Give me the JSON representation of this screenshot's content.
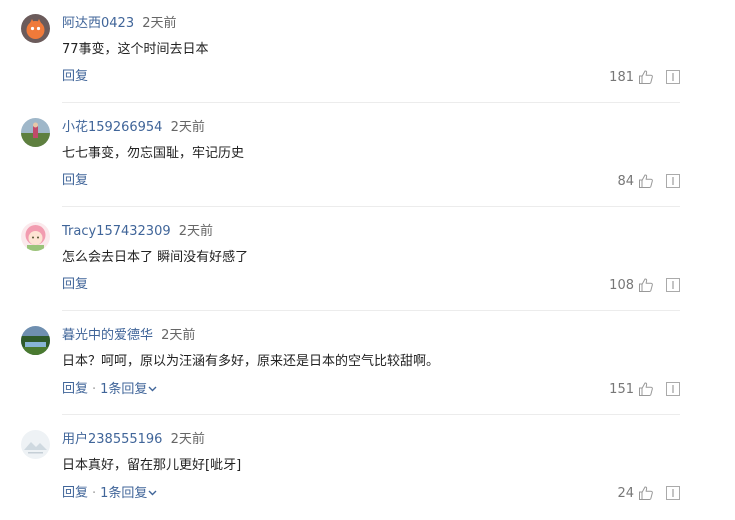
{
  "comments": [
    {
      "username": "阿达西0423",
      "time": "2天前",
      "content": "77事变，这个时间去日本",
      "reply_label": "回复",
      "likes": "181",
      "avatar": "orange-cartoon-avatar"
    },
    {
      "username": "小花159266954",
      "time": "2天前",
      "content": "七七事变，勿忘国耻，牢记历史",
      "reply_label": "回复",
      "likes": "84",
      "avatar": "outdoor-photo-avatar"
    },
    {
      "username": "Tracy157432309",
      "time": "2天前",
      "content": "怎么会去日本了 瞬间没有好感了",
      "reply_label": "回复",
      "likes": "108",
      "avatar": "pink-hair-girl-avatar"
    },
    {
      "username": "暮光中的爱德华",
      "time": "2天前",
      "content": "日本？呵呵，原以为汪涵有多好，原来还是日本的空气比较甜啊。",
      "reply_label": "回复",
      "replies_label": "1条回复",
      "likes": "151",
      "avatar": "landscape-avatar"
    },
    {
      "username": "用户238555196",
      "time": "2天前",
      "content": "日本真好，留在那儿更好[呲牙]",
      "reply_label": "回复",
      "replies_label": "1条回复",
      "likes": "24",
      "avatar": "default-avatar"
    }
  ],
  "separator": "·",
  "colors": {
    "username": "#406599",
    "action": "#406599",
    "text": "#222222",
    "muted": "#777777",
    "divider": "#ececec"
  }
}
